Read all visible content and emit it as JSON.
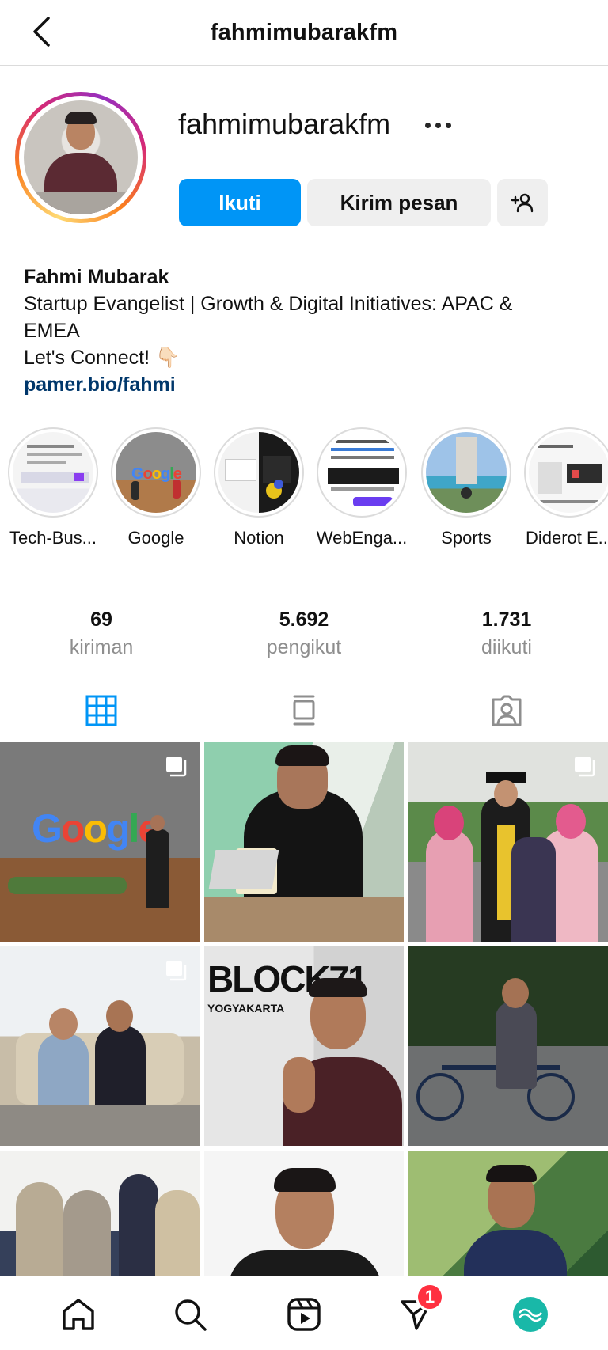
{
  "header": {
    "title": "fahmimubarakfm"
  },
  "profile": {
    "username": "fahmimubarakfm",
    "follow_label": "Ikuti",
    "message_label": "Kirim pesan",
    "bio": {
      "name": "Fahmi Mubarak",
      "line1": "Startup Evangelist | Growth & Digital Initiatives: APAC &",
      "line2": "EMEA",
      "line3": "Let's Connect! 👇🏻",
      "link": "pamer.bio/fahmi"
    }
  },
  "highlights": [
    {
      "label": "Tech-Bus..."
    },
    {
      "label": "Google"
    },
    {
      "label": "Notion"
    },
    {
      "label": "WebEnga..."
    },
    {
      "label": "Sports"
    },
    {
      "label": "Diderot E..."
    }
  ],
  "stats": {
    "posts": {
      "value": "69",
      "label": "kiriman"
    },
    "followers": {
      "value": "5.692",
      "label": "pengikut"
    },
    "following": {
      "value": "1.731",
      "label": "diikuti"
    }
  },
  "bottom_nav": {
    "badge_count": "1"
  },
  "colors": {
    "accent": "#0095f6",
    "link": "#00376b",
    "badge": "#ff3040"
  },
  "posts": {
    "count_visible": 9,
    "multi_indicator": [
      true,
      false,
      true,
      true,
      false,
      false,
      false,
      false,
      false
    ],
    "overlay_texts": {
      "post_4_sign": "BLOCK71",
      "post_4_sub": "YOGYAKARTA"
    }
  }
}
